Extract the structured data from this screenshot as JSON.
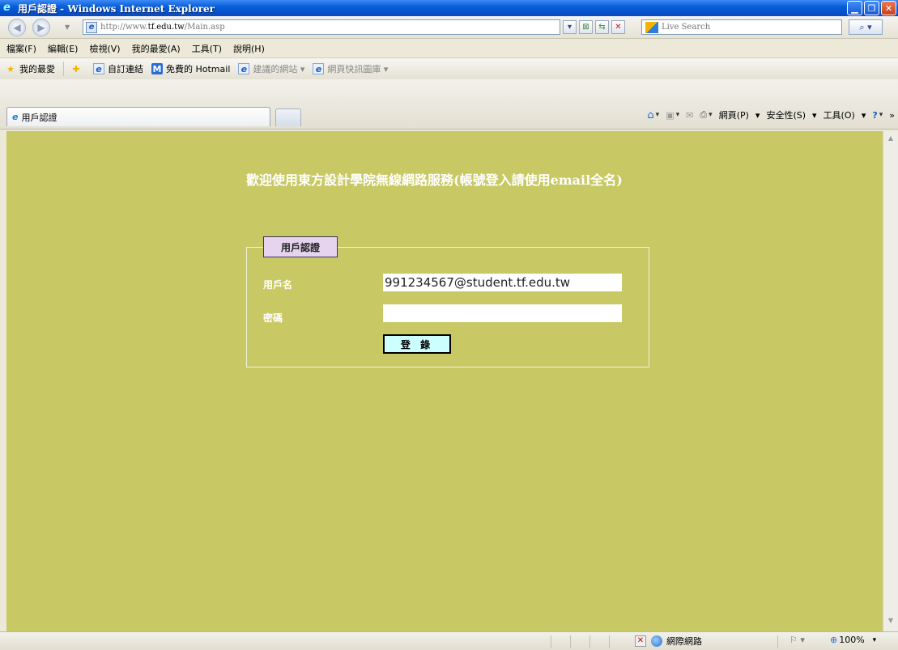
{
  "window": {
    "title": "用戶認證 - Windows Internet Explorer",
    "minimize_glyph": "▁",
    "maximize_glyph": "❐",
    "close_glyph": "✕"
  },
  "address": {
    "url_prefix": "http://www.",
    "url_domain": "tf.edu.tw",
    "url_path": "/Main.asp"
  },
  "search": {
    "placeholder": "Live Search"
  },
  "menu": {
    "items": [
      "檔案(F)",
      "編輯(E)",
      "檢視(V)",
      "我的最愛(A)",
      "工具(T)",
      "說明(H)"
    ]
  },
  "favorites_bar": {
    "favorites_label": "我的最愛",
    "custom_links": "自訂連結",
    "hotmail": "免費的 Hotmail",
    "suggested_sites": "建議的網站 ▾",
    "web_slice": "網頁快訊圖庫 ▾"
  },
  "tabs": {
    "active_tab": "用戶認證"
  },
  "command_bar": {
    "page": "網頁(P)",
    "safety": "安全性(S)",
    "tools": "工具(O)",
    "more": "»"
  },
  "page": {
    "welcome_text": "歡迎使用東方設計學院無線網路服務(帳號登入請使用email全名)",
    "auth_legend": "用戶認證",
    "username_label": "用戶名",
    "username_value": "991234567@student.tf.edu.tw",
    "password_label": "密碼",
    "password_value": "",
    "login_button": "登 錄"
  },
  "status_bar": {
    "zone": "網際網路",
    "zoom": "100%"
  },
  "icons": [
    "ie-logo-icon",
    "back-icon",
    "forward-icon",
    "page-icon",
    "refresh-icon",
    "stop-icon",
    "search-icon",
    "star-icon",
    "add-favorite-icon",
    "home-icon",
    "rss-icon",
    "mail-icon",
    "print-icon",
    "help-icon",
    "globe-icon",
    "blocked-icon",
    "zoom-icon"
  ]
}
